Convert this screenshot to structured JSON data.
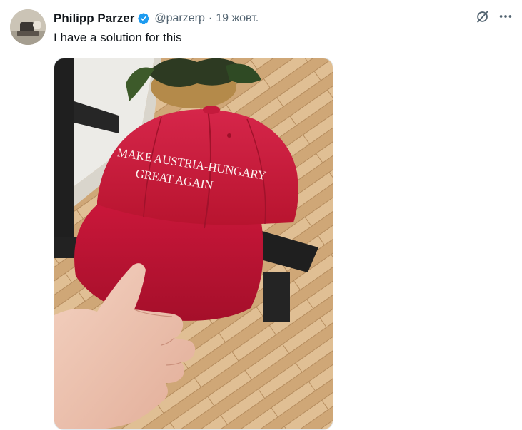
{
  "tweet": {
    "author": {
      "display_name": "Philipp Parzer",
      "handle": "@parzerp",
      "verified": true,
      "verified_icon": "verified-badge-icon"
    },
    "separator": "·",
    "timestamp": "19 жовт.",
    "text": "I have a solution for this",
    "actions": {
      "grok_icon": "grok-icon",
      "more_icon": "more-icon"
    },
    "media": {
      "cap_line1": "MAKE AUSTRIA-HUNGARY",
      "cap_line2": "GREAT AGAIN"
    }
  },
  "colors": {
    "accent": "#1d9bf0",
    "secondary_text": "#536471",
    "cap_red": "#d11e3a"
  }
}
